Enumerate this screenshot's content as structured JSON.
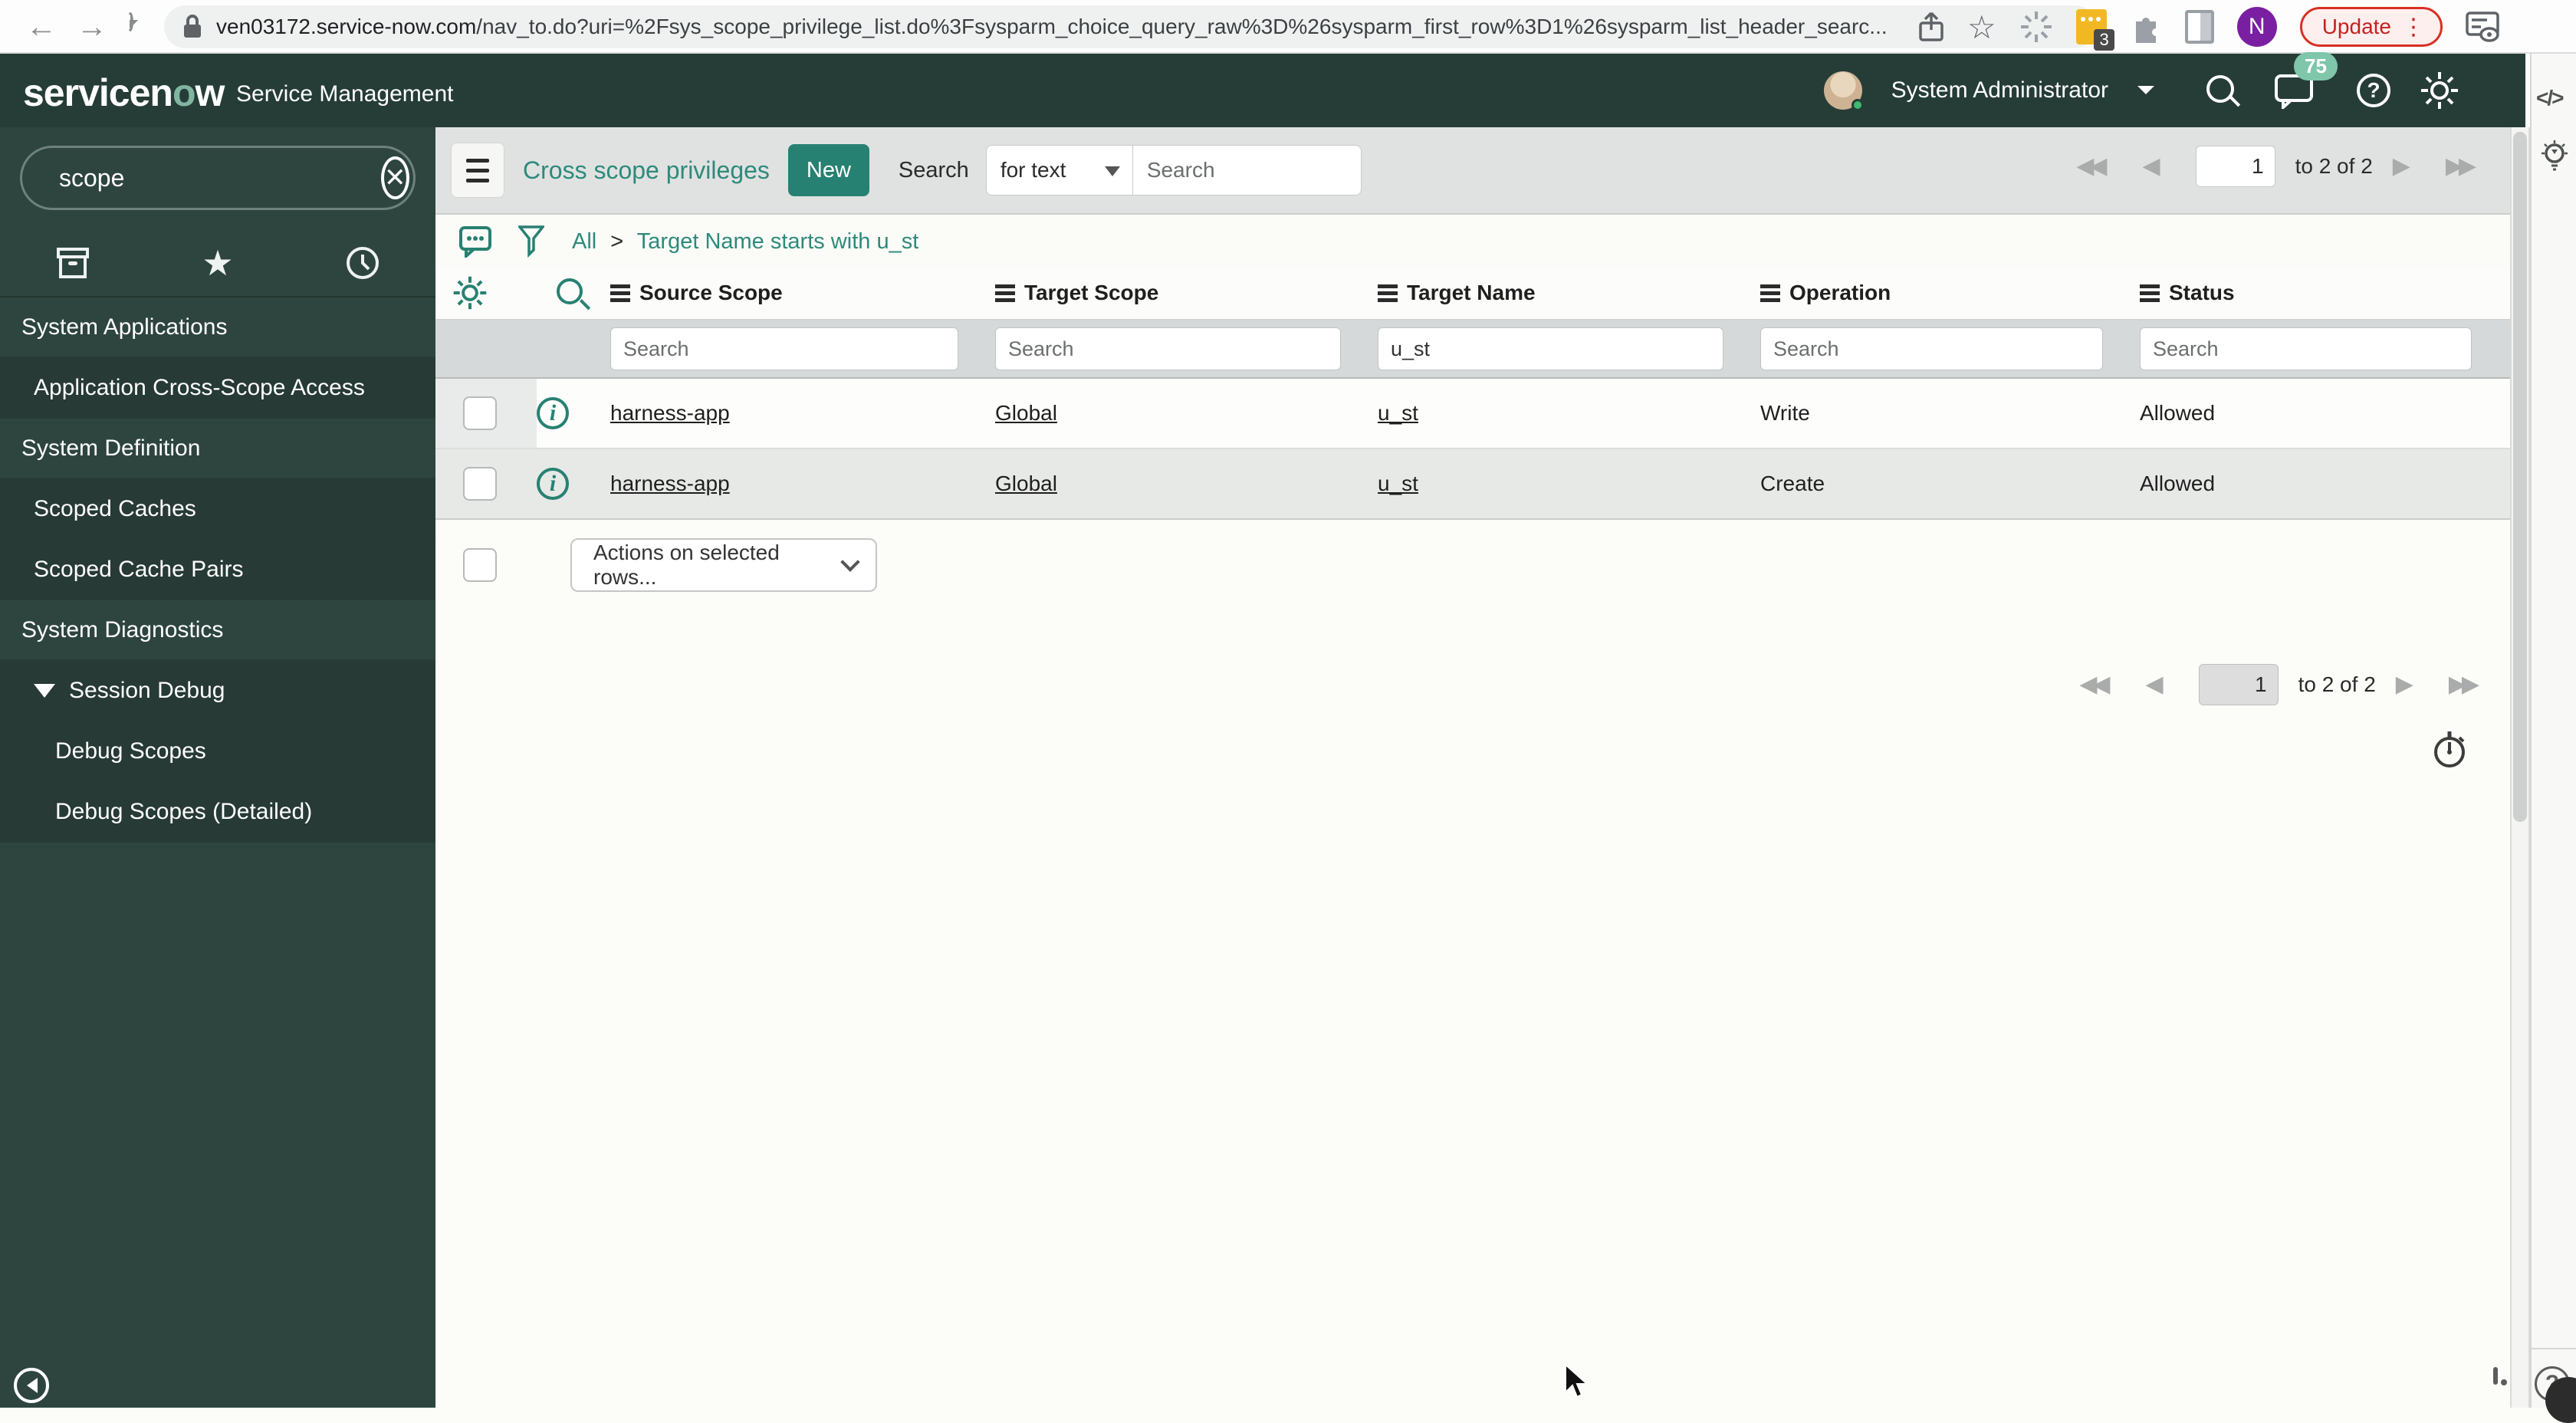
{
  "browser": {
    "url_host": "ven03172.service-now.com",
    "url_rest": "/nav_to.do?uri=%2Fsys_scope_privilege_list.do%3Fsysparm_choice_query_raw%3D%26sysparm_first_row%3D1%26sysparm_list_header_searc...",
    "update_label": "Update",
    "update_menu_glyph": "⋮",
    "extension_badge_count": "3",
    "profile_initial": "N"
  },
  "app_header": {
    "logo_left": "servicen",
    "logo_o": "o",
    "logo_right": "w",
    "subtitle": "Service Management",
    "user_name": "System Administrator",
    "notification_count": "75"
  },
  "nav_sidebar": {
    "filter_value": "scope",
    "items": [
      {
        "label": "System Applications"
      },
      {
        "label": "Application Cross-Scope Access"
      },
      {
        "label": "System Definition"
      },
      {
        "label": "Scoped Caches"
      },
      {
        "label": "Scoped Cache Pairs"
      },
      {
        "label": "System Diagnostics"
      },
      {
        "label": "Session Debug"
      },
      {
        "label": "Debug Scopes"
      },
      {
        "label": "Debug Scopes (Detailed)"
      }
    ]
  },
  "list_toolbar": {
    "title": "Cross scope privileges",
    "new_button": "New",
    "search_label": "Search",
    "search_type": "for text",
    "search_placeholder": "Search"
  },
  "breadcrumb": {
    "root": "All",
    "separator": ">",
    "condition": "Target Name starts with u_st"
  },
  "table": {
    "columns": [
      "Source Scope",
      "Target Scope",
      "Target Name",
      "Operation",
      "Status"
    ],
    "column_search_placeholder": "Search",
    "column_search_values": {
      "source_scope": "",
      "target_scope": "",
      "target_name": "u_st",
      "operation": "",
      "status": ""
    },
    "rows": [
      {
        "source_scope": "harness-app",
        "target_scope": "Global",
        "target_name": "u_st",
        "operation": "Write",
        "status": "Allowed"
      },
      {
        "source_scope": "harness-app",
        "target_scope": "Global",
        "target_name": "u_st",
        "operation": "Create",
        "status": "Allowed"
      }
    ],
    "actions_dropdown": "Actions on selected rows..."
  },
  "pagination": {
    "current_page": "1",
    "range_label": "to 2 of 2"
  },
  "right_rail": {
    "code_glyph": "</>"
  },
  "icons": {
    "star": "★",
    "back_arrow": "←",
    "forward_arrow": "→",
    "bookmark_star": "☆",
    "first_page": "◀◀",
    "prev_page": "◀",
    "next_page": "▶",
    "last_page": "▶▶"
  }
}
